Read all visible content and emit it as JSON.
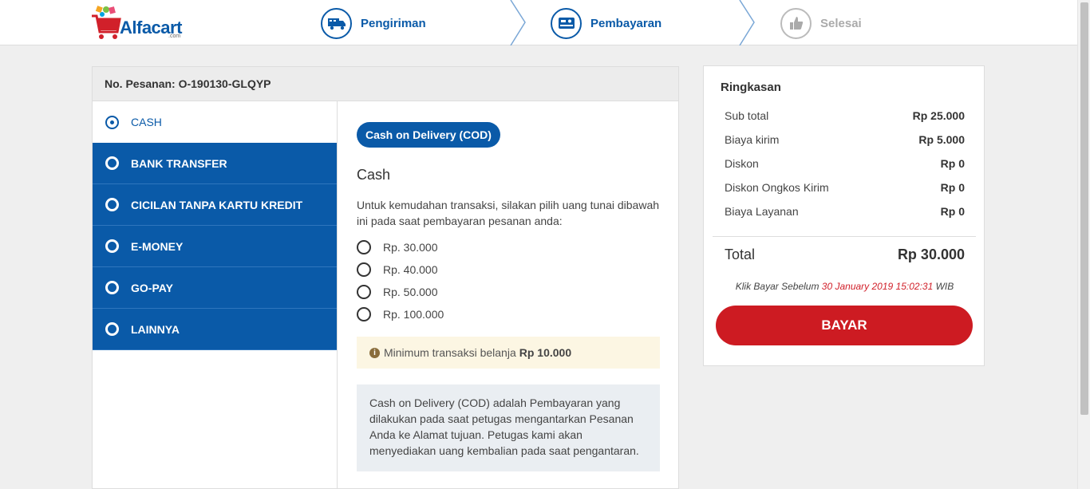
{
  "brand": {
    "name": "Alfacart",
    "sub": ".com"
  },
  "steps": [
    {
      "label": "Pengiriman",
      "icon": "truck-icon",
      "state": "active"
    },
    {
      "label": "Pembayaran",
      "icon": "card-icon",
      "state": "active"
    },
    {
      "label": "Selesai",
      "icon": "thumbs-up-icon",
      "state": "pending"
    }
  ],
  "order": {
    "label": "No. Pesanan: O-190130-GLQYP"
  },
  "methods": [
    {
      "label": "CASH",
      "selected": true
    },
    {
      "label": "BANK TRANSFER",
      "selected": false
    },
    {
      "label": "CICILAN TANPA KARTU KREDIT",
      "selected": false
    },
    {
      "label": "E-MONEY",
      "selected": false
    },
    {
      "label": "GO-PAY",
      "selected": false
    },
    {
      "label": "LAINNYA",
      "selected": false
    }
  ],
  "detail": {
    "pill": "Cash on Delivery (COD)",
    "title": "Cash",
    "desc": "Untuk kemudahan transaksi, silakan pilih uang tunai dibawah ini pada saat pembayaran pesanan anda:",
    "amounts": [
      "Rp. 30.000",
      "Rp. 40.000",
      "Rp. 50.000",
      "Rp. 100.000"
    ],
    "min_text": "Minimum transaksi belanja",
    "min_value": "Rp 10.000",
    "cod_info": "Cash on Delivery (COD) adalah Pembayaran yang dilakukan pada saat petugas mengantarkan Pesanan Anda ke Alamat tujuan. Petugas kami akan menyediakan uang kembalian pada saat pengantaran."
  },
  "summary": {
    "title": "Ringkasan",
    "rows": [
      {
        "label": "Sub total",
        "value": "Rp 25.000"
      },
      {
        "label": "Biaya kirim",
        "value": "Rp 5.000"
      },
      {
        "label": "Diskon",
        "value": "Rp 0"
      },
      {
        "label": "Diskon Ongkos Kirim",
        "value": "Rp 0"
      },
      {
        "label": "Biaya Layanan",
        "value": "Rp 0"
      }
    ],
    "total_label": "Total",
    "total_value": "Rp 30.000",
    "deadline_prefix": "Klik Bayar Sebelum",
    "deadline_date": "30 January 2019 15:02:31",
    "deadline_suffix": "WIB",
    "pay_button": "BAYAR"
  },
  "colors": {
    "primary": "#0a5aa8",
    "danger": "#cd1b22",
    "deadline": "#d1202a",
    "warning_bg": "#fcf6e3"
  }
}
